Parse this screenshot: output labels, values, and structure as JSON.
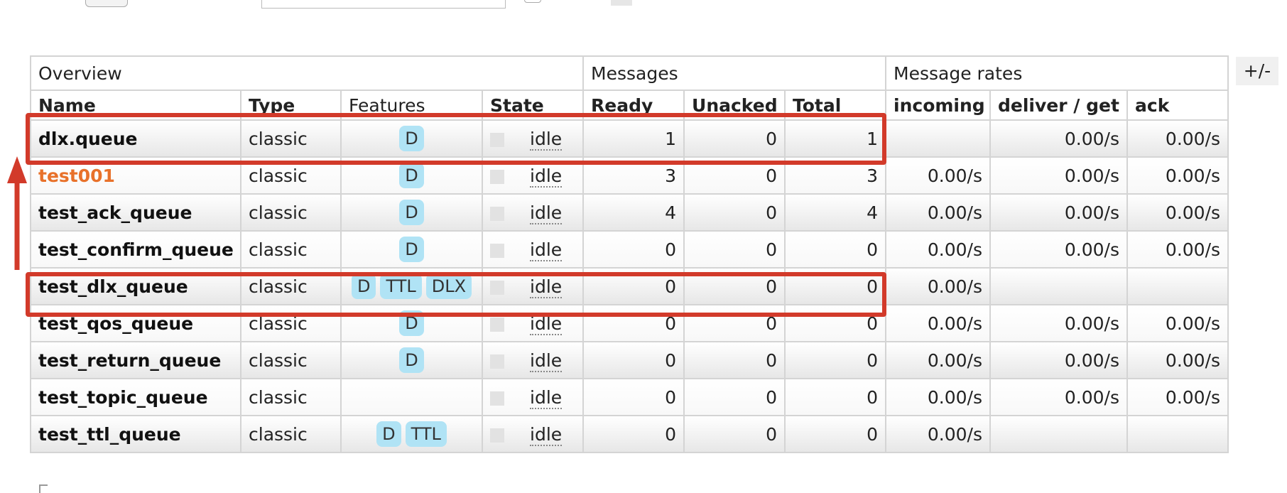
{
  "group_headers": [
    "Overview",
    "Messages",
    "Message rates"
  ],
  "columns": {
    "name": "Name",
    "type": "Type",
    "features": "Features",
    "state": "State",
    "ready": "Ready",
    "unacked": "Unacked",
    "total": "Total",
    "incoming": "incoming",
    "deliver_get": "deliver / get",
    "ack": "ack"
  },
  "toggle_label": "+/-",
  "queues": [
    {
      "name": "dlx.queue",
      "type": "classic",
      "features": [
        "D"
      ],
      "state": "idle",
      "ready": "1",
      "unacked": "0",
      "total": "1",
      "incoming": "",
      "deliver_get": "0.00/s",
      "ack": "0.00/s"
    },
    {
      "name": "test001",
      "type": "classic",
      "features": [
        "D"
      ],
      "state": "idle",
      "ready": "3",
      "unacked": "0",
      "total": "3",
      "incoming": "0.00/s",
      "deliver_get": "0.00/s",
      "ack": "0.00/s"
    },
    {
      "name": "test_ack_queue",
      "type": "classic",
      "features": [
        "D"
      ],
      "state": "idle",
      "ready": "4",
      "unacked": "0",
      "total": "4",
      "incoming": "0.00/s",
      "deliver_get": "0.00/s",
      "ack": "0.00/s"
    },
    {
      "name": "test_confirm_queue",
      "type": "classic",
      "features": [
        "D"
      ],
      "state": "idle",
      "ready": "0",
      "unacked": "0",
      "total": "0",
      "incoming": "0.00/s",
      "deliver_get": "0.00/s",
      "ack": "0.00/s"
    },
    {
      "name": "test_dlx_queue",
      "type": "classic",
      "features": [
        "D",
        "TTL",
        "DLX"
      ],
      "state": "idle",
      "ready": "0",
      "unacked": "0",
      "total": "0",
      "incoming": "0.00/s",
      "deliver_get": "",
      "ack": ""
    },
    {
      "name": "test_qos_queue",
      "type": "classic",
      "features": [
        "D"
      ],
      "state": "idle",
      "ready": "0",
      "unacked": "0",
      "total": "0",
      "incoming": "0.00/s",
      "deliver_get": "0.00/s",
      "ack": "0.00/s"
    },
    {
      "name": "test_return_queue",
      "type": "classic",
      "features": [
        "D"
      ],
      "state": "idle",
      "ready": "0",
      "unacked": "0",
      "total": "0",
      "incoming": "0.00/s",
      "deliver_get": "0.00/s",
      "ack": "0.00/s"
    },
    {
      "name": "test_topic_queue",
      "type": "classic",
      "features": [],
      "state": "idle",
      "ready": "0",
      "unacked": "0",
      "total": "0",
      "incoming": "0.00/s",
      "deliver_get": "0.00/s",
      "ack": "0.00/s"
    },
    {
      "name": "test_ttl_queue",
      "type": "classic",
      "features": [
        "D",
        "TTL"
      ],
      "state": "idle",
      "ready": "0",
      "unacked": "0",
      "total": "0",
      "incoming": "0.00/s",
      "deliver_get": "",
      "ack": ""
    }
  ],
  "colors": {
    "accent_orange": "#e8712a",
    "badge_bg": "#b0e3f5",
    "highlight_red": "#d23a2a"
  }
}
